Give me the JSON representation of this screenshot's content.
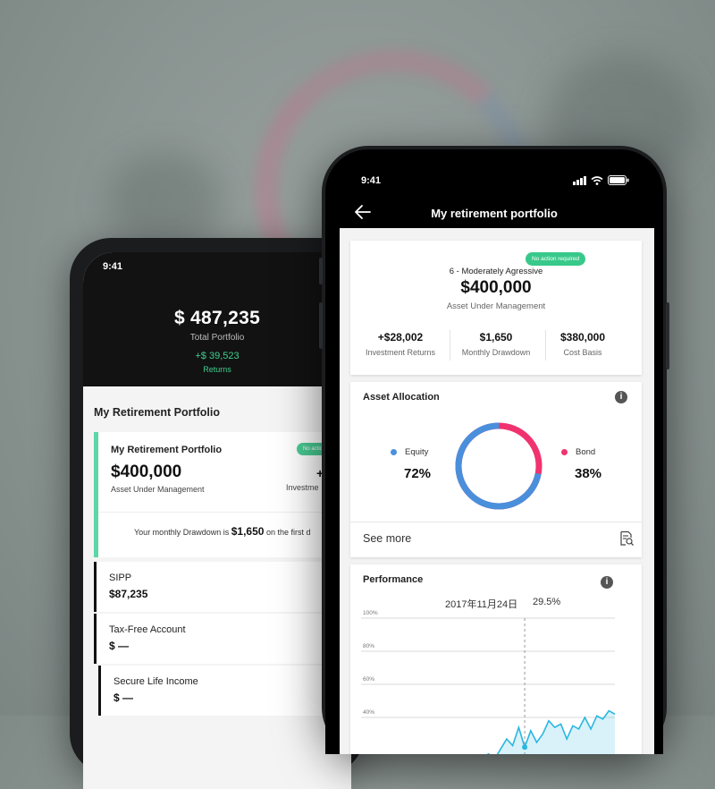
{
  "back_phone": {
    "status_time": "9:41",
    "total_value": "$ 487,235",
    "total_label": "Total Portfolio",
    "returns_value": "+$ 39,523",
    "returns_label": "Returns",
    "section_title": "My Retirement Portfolio",
    "card": {
      "title": "My Retirement Portfolio",
      "badge": "No action",
      "amount": "$400,000",
      "amount_label": "Asset Under Management",
      "stat_prefix": "+",
      "stat_label": "Investme",
      "drawdown_prefix": "Your monthly Drawdown is",
      "drawdown_value": "$1,650",
      "drawdown_suffix": "on the first d"
    },
    "accounts": [
      {
        "name": "SIPP",
        "value": "$87,235"
      },
      {
        "name": "Tax-Free Account",
        "value": "$ —"
      },
      {
        "name": "Secure Life Income",
        "value": "$ —"
      }
    ]
  },
  "front_phone": {
    "status_time": "9:41",
    "title": "My retirement portfolio",
    "summary": {
      "badge": "No action required",
      "risk_profile": "6 - Moderately Agressive",
      "aum_value": "$400,000",
      "aum_label": "Asset Under Management",
      "stats": [
        {
          "value": "+$28,002",
          "label": "Investment Returns"
        },
        {
          "value": "$1,650",
          "label": "Monthly Drawdown"
        },
        {
          "value": "$380,000",
          "label": "Cost Basis"
        }
      ]
    },
    "allocation": {
      "title": "Asset Allocation",
      "equity_label": "Equity",
      "equity_pct": "72%",
      "bond_label": "Bond",
      "bond_pct": "38%",
      "see_more": "See more",
      "equity_fraction": 0.72,
      "colors": {
        "equity": "#4a8fdc",
        "bond": "#f0336f"
      }
    },
    "performance": {
      "title": "Performance",
      "selected_date": "2017年11月24日",
      "selected_value": "29.5%",
      "chart_data": {
        "type": "area",
        "y_ticks": [
          "100%",
          "80%",
          "60%",
          "40%"
        ],
        "ylim": [
          0,
          100
        ],
        "values": [
          16,
          18,
          15,
          21,
          27,
          23,
          34,
          22,
          32,
          25,
          30,
          38,
          34,
          36,
          27,
          35,
          33,
          40,
          33,
          41,
          39,
          44,
          42
        ],
        "marker_index": 7,
        "color": "#2bb7e0",
        "grid": true
      }
    }
  }
}
